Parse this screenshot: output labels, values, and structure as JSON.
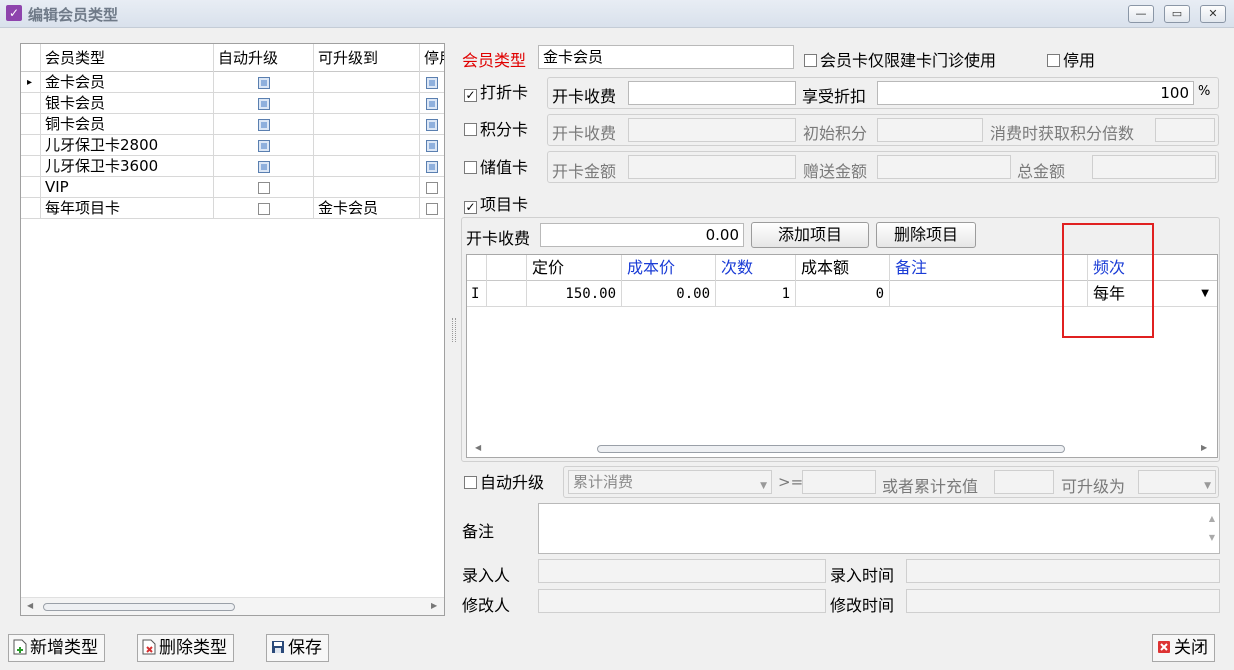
{
  "window": {
    "title": "编辑会员类型",
    "controls": [
      "minimize-icon",
      "maximize-icon",
      "close-icon"
    ]
  },
  "left_grid": {
    "columns": [
      "会员类型",
      "自动升级",
      "可升级到",
      "停用"
    ],
    "rows": [
      {
        "name": "金卡会员",
        "auto_upgrade": true,
        "upgrade_to": "",
        "disabled": true,
        "selected": true
      },
      {
        "name": "银卡会员",
        "auto_upgrade": true,
        "upgrade_to": "",
        "disabled": true
      },
      {
        "name": "铜卡会员",
        "auto_upgrade": true,
        "upgrade_to": "",
        "disabled": true
      },
      {
        "name": "儿牙保卫卡2800",
        "auto_upgrade": true,
        "upgrade_to": "",
        "disabled": true
      },
      {
        "name": "儿牙保卫卡3600",
        "auto_upgrade": true,
        "upgrade_to": "",
        "disabled": true
      },
      {
        "name": "VIP",
        "auto_upgrade": false,
        "upgrade_to": "",
        "disabled": false
      },
      {
        "name": "每年项目卡",
        "auto_upgrade": false,
        "upgrade_to": "金卡会员",
        "disabled": false
      }
    ]
  },
  "form": {
    "member_type_label": "会员类型",
    "member_type_value": "金卡会员",
    "limit_clinic_label": "会员卡仅限建卡门诊使用",
    "stop_label": "停用",
    "discount_card": {
      "label": "打折卡",
      "checked": true,
      "fee_label": "开卡收费",
      "fee_value": "",
      "discount_label": "享受折扣",
      "discount_value": "100",
      "discount_unit": "%"
    },
    "points_card": {
      "label": "积分卡",
      "checked": false,
      "fee_label": "开卡收费",
      "initial_label": "初始积分",
      "multiplier_label": "消费时获取积分倍数"
    },
    "stored_value_card": {
      "label": "储值卡",
      "checked": false,
      "amount_label": "开卡金额",
      "bonus_label": "赠送金额",
      "total_label": "总金额"
    },
    "item_card": {
      "label": "项目卡",
      "checked": true,
      "fee_label": "开卡收费",
      "fee_value": "0.00",
      "add_button": "添加项目",
      "delete_button": "删除项目"
    },
    "item_grid": {
      "columns": [
        {
          "label": "",
          "blue": false
        },
        {
          "label": "",
          "blue": false
        },
        {
          "label": "定价",
          "blue": false
        },
        {
          "label": "成本价",
          "blue": true
        },
        {
          "label": "次数",
          "blue": true
        },
        {
          "label": "成本额",
          "blue": false
        },
        {
          "label": "备注",
          "blue": true
        },
        {
          "label": "频次",
          "blue": true
        }
      ],
      "rows": [
        {
          "indicator": "I",
          "name": "",
          "price": "150.00",
          "cost_price": "0.00",
          "count": "1",
          "cost_amount": "0",
          "remark": "",
          "frequency": "每年"
        }
      ]
    },
    "auto_upgrade": {
      "label": "自动升级",
      "checked": false,
      "condition_value": "累计消费",
      "operator": ">=",
      "or_label": "或者累计充值",
      "upgrade_to_label": "可升级为"
    },
    "remark_label": "备注",
    "entered_by_label": "录入人",
    "entered_time_label": "录入时间",
    "modified_by_label": "修改人",
    "modified_time_label": "修改时间"
  },
  "toolbar": {
    "add_type": "新增类型",
    "delete_type": "删除类型",
    "save": "保存",
    "close": "关闭"
  },
  "colors": {
    "highlight_box": "#e02020",
    "required_label": "#e00000",
    "blue_column_header": "#1a3cd6"
  }
}
